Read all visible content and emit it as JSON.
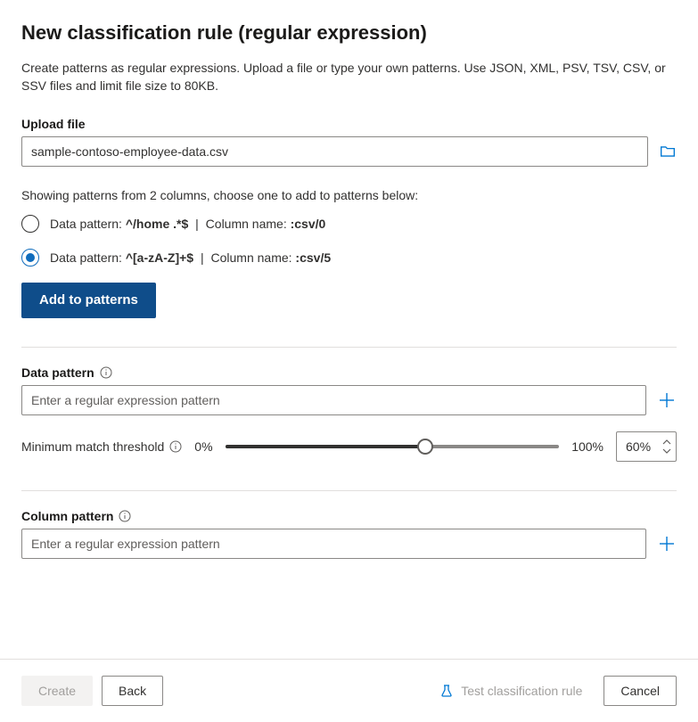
{
  "title": "New classification rule (regular expression)",
  "description": "Create patterns as regular expressions. Upload a file or type your own patterns. Use JSON, XML, PSV, TSV, CSV, or SSV files and limit file size to 80KB.",
  "upload": {
    "label": "Upload file",
    "value": "sample-contoso-employee-data.csv"
  },
  "patterns_hint": "Showing patterns from 2 columns, choose one to add to patterns below:",
  "radio_options": [
    {
      "prefix": "Data pattern: ",
      "pattern": "^/home .*$",
      "sep": " | ",
      "col_prefix": "Column name: ",
      "col_name": ":csv/0",
      "selected": false
    },
    {
      "prefix": "Data pattern: ",
      "pattern": "^[a-zA-Z]+$",
      "sep": " | ",
      "col_prefix": "Column name: ",
      "col_name": ":csv/5",
      "selected": true
    }
  ],
  "add_to_patterns_label": "Add to patterns",
  "data_pattern": {
    "label": "Data pattern",
    "placeholder": "Enter a regular expression pattern"
  },
  "threshold": {
    "label": "Minimum match threshold",
    "min_label": "0%",
    "max_label": "100%",
    "value": "60%",
    "percent": 60
  },
  "column_pattern": {
    "label": "Column pattern",
    "placeholder": "Enter a regular expression pattern"
  },
  "footer": {
    "create": "Create",
    "back": "Back",
    "test": "Test classification rule",
    "cancel": "Cancel"
  }
}
